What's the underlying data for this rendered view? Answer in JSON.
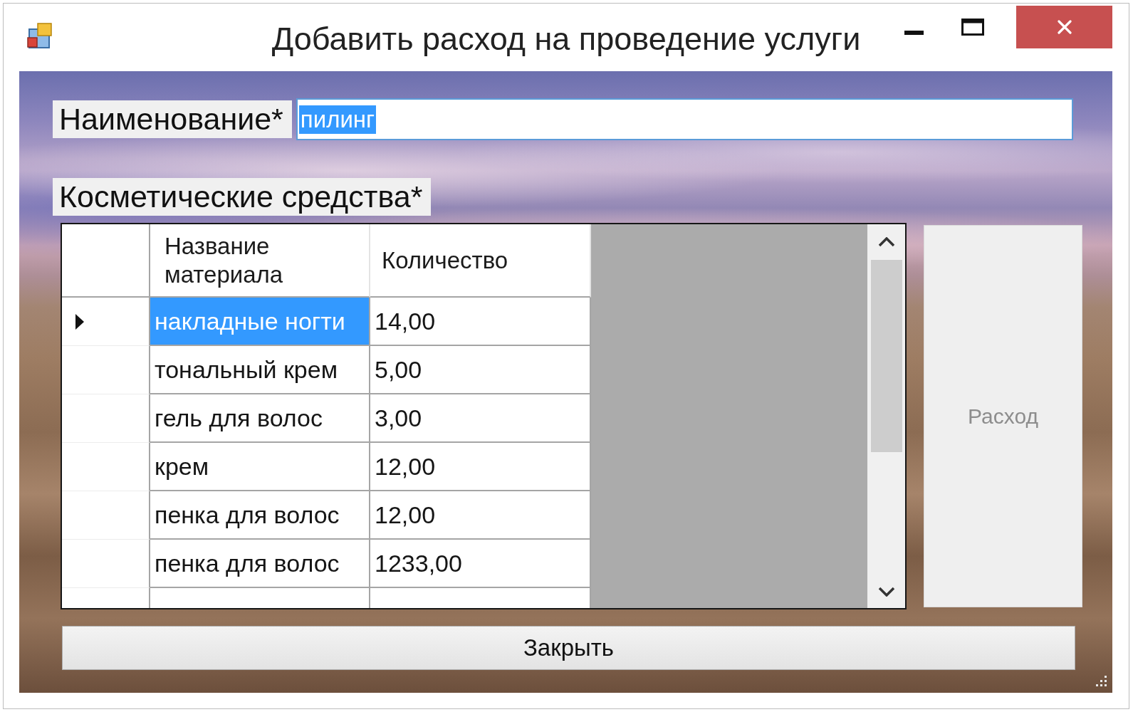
{
  "window": {
    "title": "Добавить расход на проведение услуги"
  },
  "name_field": {
    "label": "Наименование*",
    "value": "пилинг",
    "value_selected": true
  },
  "materials": {
    "label": "Косметические средства*",
    "columns": [
      "Название материала",
      "Количество"
    ],
    "rows": [
      {
        "current": true,
        "cells": [
          {
            "text": "накладные ногти",
            "selected": true
          },
          {
            "text": "14,00",
            "selected": false
          }
        ]
      },
      {
        "current": false,
        "cells": [
          {
            "text": "тональный крем",
            "selected": false
          },
          {
            "text": "5,00",
            "selected": false
          }
        ]
      },
      {
        "current": false,
        "cells": [
          {
            "text": "гель для волос",
            "selected": false
          },
          {
            "text": "3,00",
            "selected": false
          }
        ]
      },
      {
        "current": false,
        "cells": [
          {
            "text": "крем",
            "selected": false
          },
          {
            "text": "12,00",
            "selected": false
          }
        ]
      },
      {
        "current": false,
        "cells": [
          {
            "text": "пенка для волос",
            "selected": false
          },
          {
            "text": "12,00",
            "selected": false
          }
        ]
      },
      {
        "current": false,
        "cells": [
          {
            "text": "пенка для волос",
            "selected": false
          },
          {
            "text": "1233,00",
            "selected": false
          }
        ]
      }
    ]
  },
  "expense_button": {
    "label": "Расход",
    "disabled": true
  },
  "close_button": {
    "label": "Закрыть"
  }
}
